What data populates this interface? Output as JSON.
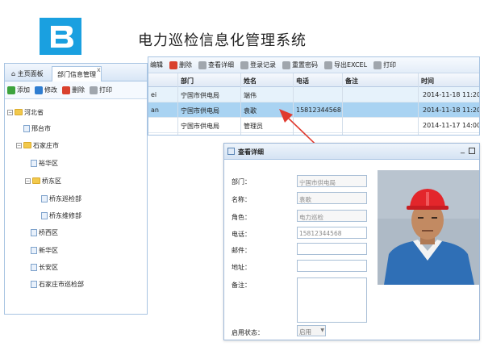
{
  "header": {
    "title": "电力巡检信息化管理系统"
  },
  "tabs": [
    {
      "label": "主页面板"
    },
    {
      "label": "部门信息管理",
      "close": "x"
    }
  ],
  "left_toolbar": {
    "add": "添加",
    "edit": "修改",
    "delete": "删除",
    "print": "打印"
  },
  "tree": {
    "root": "河北省",
    "items": [
      {
        "label": "邢台市"
      },
      {
        "label": "石家庄市"
      },
      {
        "label": "裕华区"
      },
      {
        "label": "桥东区"
      },
      {
        "label": "桥东巡检部"
      },
      {
        "label": "桥东维修部"
      },
      {
        "label": "桥西区"
      },
      {
        "label": "新华区"
      },
      {
        "label": "长安区"
      },
      {
        "label": "石家庄市巡检部"
      }
    ]
  },
  "grid_toolbar": {
    "edit": "编辑",
    "delete": "删除",
    "view": "查看详细",
    "login": "登录记录",
    "reset_pwd": "重置密码",
    "export": "导出EXCEL",
    "print": "打印"
  },
  "grid": {
    "columns": [
      "部门",
      "姓名",
      "电话",
      "备注",
      "时间"
    ],
    "rows": [
      {
        "frag": "ei",
        "dept": "宁国市供电局",
        "name": "端伟",
        "phone": "",
        "note": "",
        "time": "2014-11-18 11:20:3"
      },
      {
        "frag": "an",
        "dept": "宁国市供电局",
        "name": "袁歌",
        "phone": "15812344568",
        "note": "",
        "time": "2014-11-18 11:20:1"
      },
      {
        "frag": "",
        "dept": "宁国市供电局",
        "name": "管理员",
        "phone": "",
        "note": "",
        "time": "2014-11-17 14:00:4"
      }
    ]
  },
  "detail": {
    "title": "查看详细",
    "min": "_",
    "labels": {
      "dept": "部门：",
      "name": "名称：",
      "role": "角色：",
      "phone": "电话：",
      "email": "邮件：",
      "address": "地址：",
      "note": "备注：",
      "status": "启用状态："
    },
    "values": {
      "dept": "宁国市供电局",
      "name": "袁歌",
      "role": "电力巡检",
      "phone": "15812344568",
      "email": "",
      "address": "",
      "note": "",
      "status": "启用"
    }
  },
  "colors": {
    "brand": "#1aa0e0",
    "selected_row": "#a9d3f2",
    "arrow": "#e03a2f"
  }
}
